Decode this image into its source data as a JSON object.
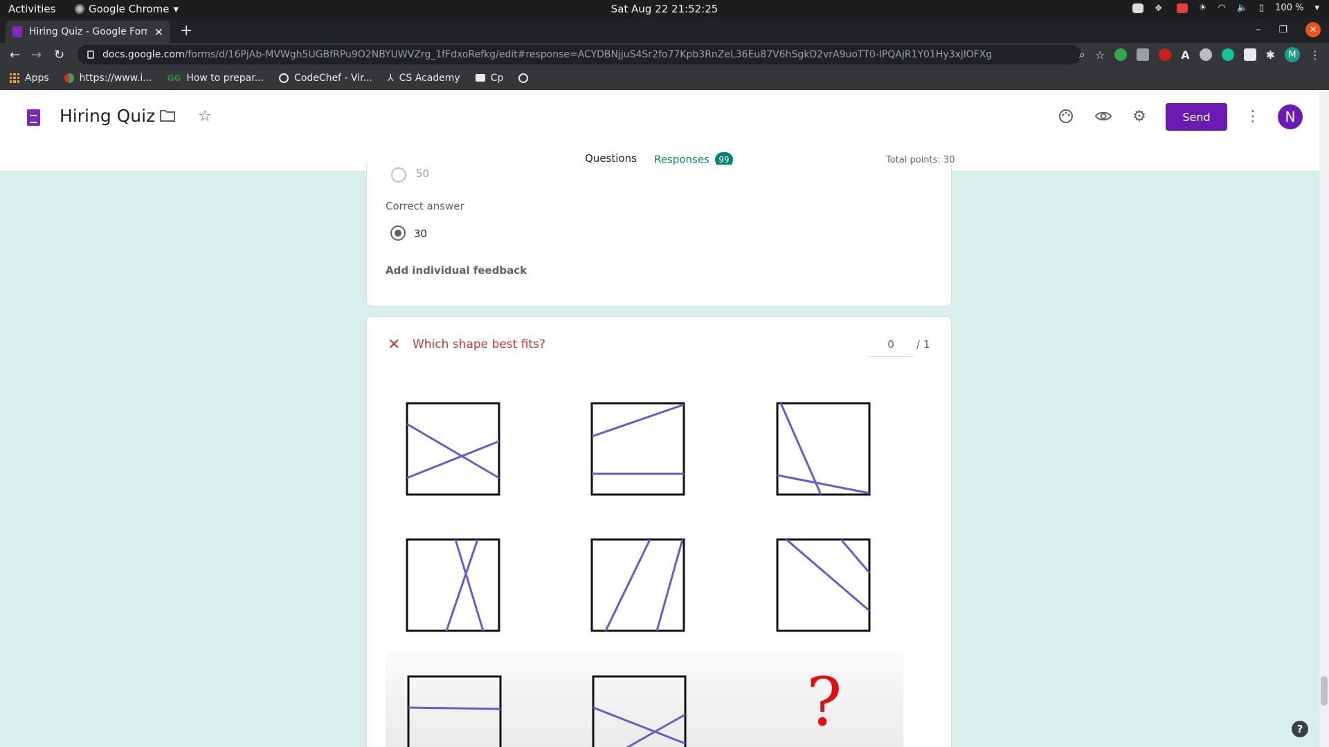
{
  "system": {
    "activities": "Activities",
    "app": "Google Chrome",
    "clock": "Sat Aug 22  21:52:25",
    "battery": "100 %"
  },
  "browser": {
    "tab_title": "Hiring Quiz - Google Forms",
    "url_host": "docs.google.com",
    "url_path": "/forms/d/16PjAb-MVWgh5UGBfRPu9O2NBYUWVZrg_1fFdxoRefkg/edit#response=ACYDBNjjuS4Sr2fo77Kpb3RnZeL36Eu87V6hSgkD2vrA9uoTT0-IPQAjR1Y01Hy3xjlOFXg",
    "profile_initial": "M",
    "bookmarks": [
      "Apps",
      "https://www.i...",
      "How to prepar...",
      "CodeChef - Vir...",
      "CS Academy",
      "Cp"
    ]
  },
  "form": {
    "title": "Hiring Quiz",
    "send_label": "Send",
    "avatar_initial": "N",
    "tabs": {
      "questions": "Questions",
      "responses": "Responses",
      "responses_count": "99"
    },
    "total_points": "Total points: 30"
  },
  "prev_question": {
    "option_value": "50",
    "correct_answer_label": "Correct answer",
    "correct_answer": "30",
    "feedback_label": "Add individual feedback"
  },
  "question": {
    "text": "Which shape best fits?",
    "score": "0",
    "out_of": "/ 1",
    "mystery": "?"
  },
  "colors": {
    "purple": "#6a1bb3",
    "teal": "#008475",
    "incorrect_red": "#d93025",
    "shape_line": "#6a5acd"
  }
}
